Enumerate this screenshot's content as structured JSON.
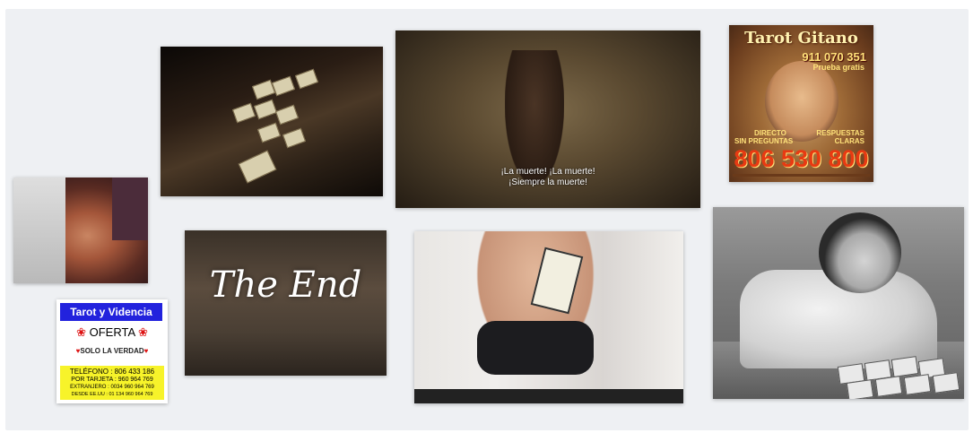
{
  "tiles": {
    "cave": {
      "subtitle_line1": "¡La muerte! ¡La muerte!",
      "subtitle_line2": "¡Siempre la muerte!"
    },
    "end": {
      "text": "The End"
    },
    "ad": {
      "header": "Tarot y Videncia",
      "offer": "OFERTA",
      "truth": "SOLO LA VERDAD",
      "line1": "TELÉFONO : 806 433 186",
      "line2": "POR TARJETA : 960 964 769",
      "line3": "EXTRANJERO : 0034 960 964 769",
      "line4": "DESDE EE.UU : 01 134 960 964 769"
    },
    "gitano": {
      "title": "Tarot Gitano",
      "phone_top": "911 070 351",
      "free": "Prueba gratis",
      "direct": "DIRECTO",
      "answers": "RESPUESTAS",
      "no_questions": "SIN PREGUNTAS",
      "clear": "CLARAS",
      "phone_big": "806 530 800"
    }
  }
}
